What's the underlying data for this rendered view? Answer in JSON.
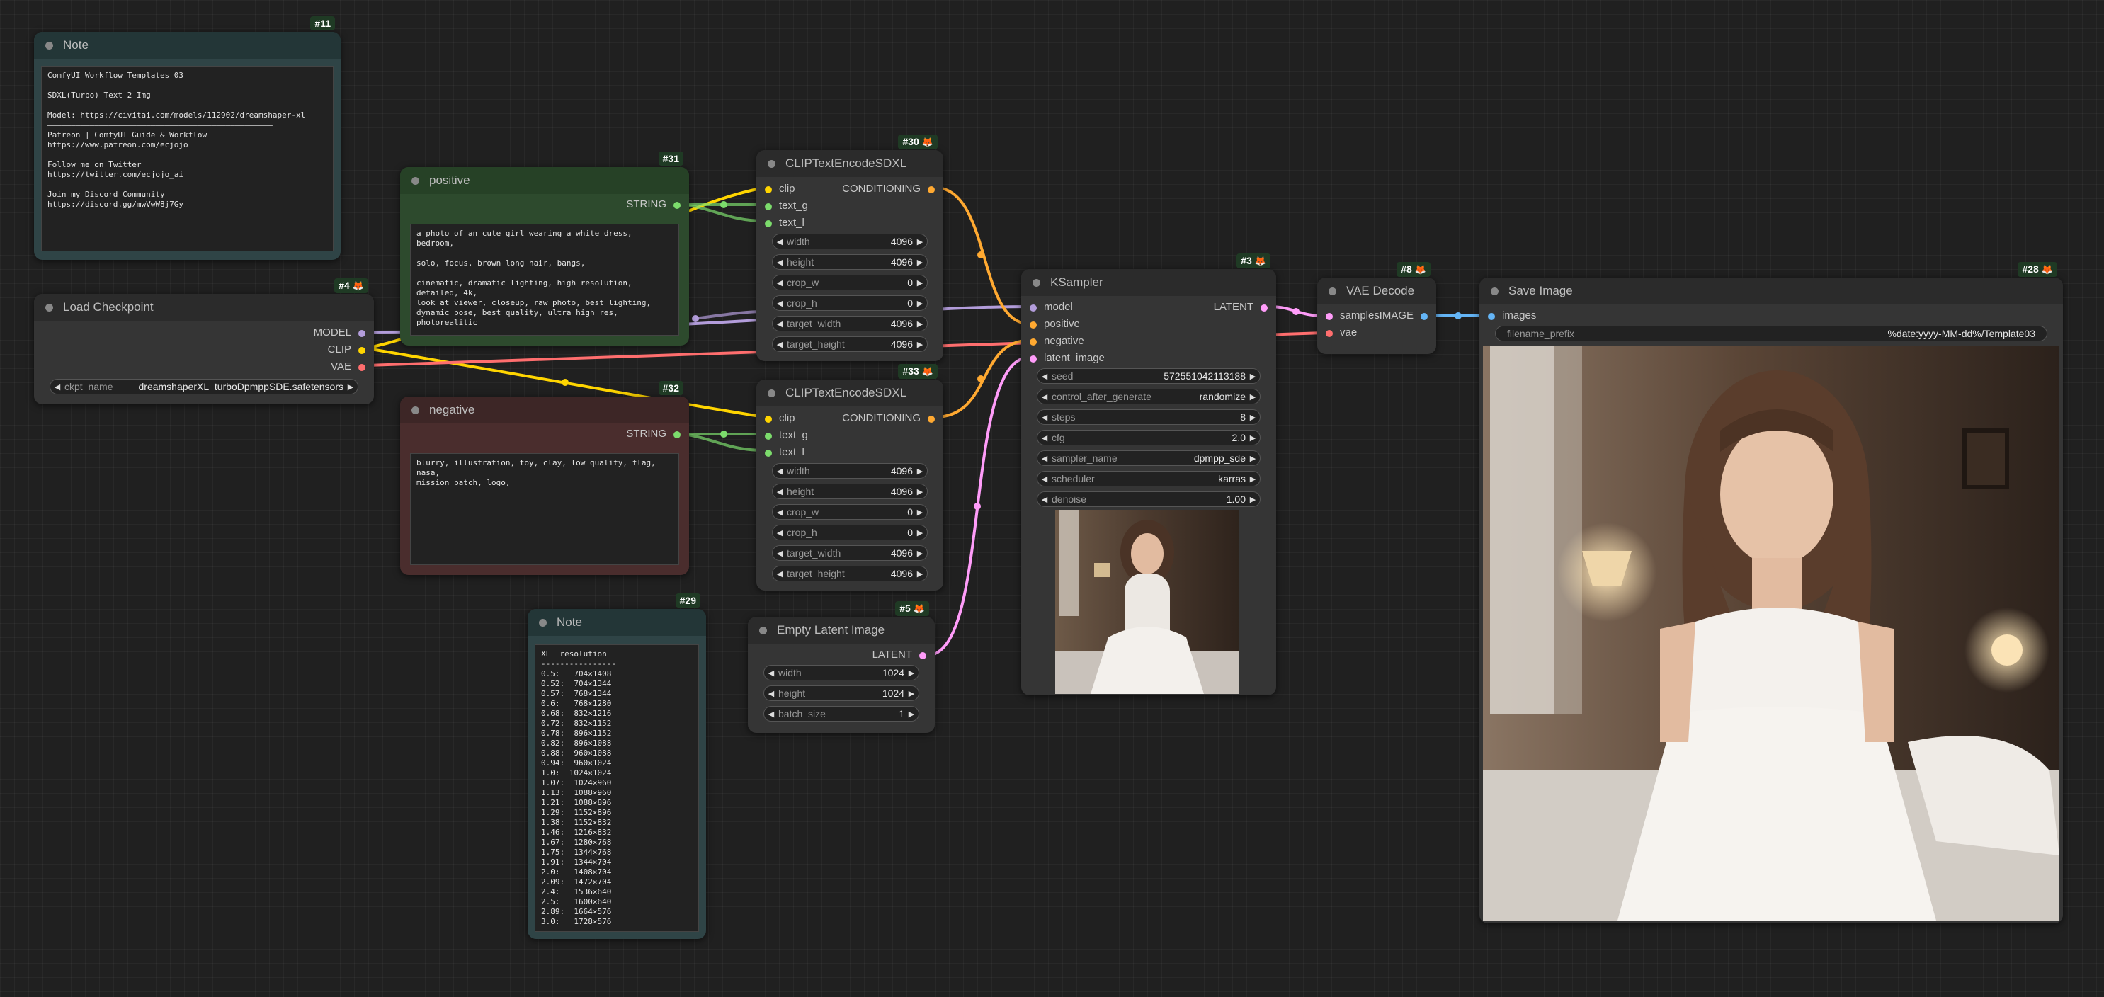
{
  "colors": {
    "model": "#b39ddb",
    "clip": "#ffd500",
    "vae": "#ff6e6e",
    "conditioning": "#ffa931",
    "latent": "#ff9cf9",
    "image": "#64b5f6",
    "string": "#7cdc6c",
    "int": "#aaaaaa"
  },
  "note11": {
    "badge": "#11",
    "title": "Note",
    "text": "ComfyUI Workflow Templates 03\n\nSDXL(Turbo) Text 2 Img\n\nModel: https://civitai.com/models/112902/dreamshaper-xl\n————————————————————————————————————————————————\nPatreon | ComfyUI Guide & Workflow\nhttps://www.patreon.com/ecjojo\n\nFollow me on Twitter\nhttps://twitter.com/ecjojo_ai\n\nJoin my Discord Community\nhttps://discord.gg/mwVwW8j7Gy"
  },
  "positive": {
    "badge": "#31",
    "title": "positive",
    "output": "STRING",
    "text": "a photo of an cute girl wearing a white dress, bedroom,\n\nsolo, focus, brown long hair, bangs,\n\ncinematic, dramatic lighting, high resolution, detailed, 4k,\nlook at viewer, closeup, raw photo, best lighting,\ndynamic pose, best quality, ultra high res, photorealitic"
  },
  "negative": {
    "badge": "#32",
    "title": "negative",
    "output": "STRING",
    "text": "blurry, illustration, toy, clay, low quality, flag, nasa,\nmission patch, logo,"
  },
  "load_checkpoint": {
    "badge": "#4",
    "title": "Load Checkpoint",
    "outputs": [
      "MODEL",
      "CLIP",
      "VAE"
    ],
    "widget_name": "ckpt_name",
    "widget_value": "dreamshaperXL_turboDpmppSDE.safetensors"
  },
  "clip30": {
    "badge": "#30",
    "title": "CLIPTextEncodeSDXL",
    "inputs": [
      "clip",
      "text_g",
      "text_l"
    ],
    "output": "CONDITIONING",
    "widgets": [
      {
        "name": "width",
        "value": "4096"
      },
      {
        "name": "height",
        "value": "4096"
      },
      {
        "name": "crop_w",
        "value": "0"
      },
      {
        "name": "crop_h",
        "value": "0"
      },
      {
        "name": "target_width",
        "value": "4096"
      },
      {
        "name": "target_height",
        "value": "4096"
      }
    ]
  },
  "clip33": {
    "badge": "#33",
    "title": "CLIPTextEncodeSDXL",
    "inputs": [
      "clip",
      "text_g",
      "text_l"
    ],
    "output": "CONDITIONING",
    "widgets": [
      {
        "name": "width",
        "value": "4096"
      },
      {
        "name": "height",
        "value": "4096"
      },
      {
        "name": "crop_w",
        "value": "0"
      },
      {
        "name": "crop_h",
        "value": "0"
      },
      {
        "name": "target_width",
        "value": "4096"
      },
      {
        "name": "target_height",
        "value": "4096"
      }
    ]
  },
  "ksampler": {
    "badge": "#3",
    "title": "KSampler",
    "inputs": [
      "model",
      "positive",
      "negative",
      "latent_image"
    ],
    "output": "LATENT",
    "widgets": [
      {
        "name": "seed",
        "value": "572551042113188"
      },
      {
        "name": "control_after_generate",
        "value": "randomize"
      },
      {
        "name": "steps",
        "value": "8"
      },
      {
        "name": "cfg",
        "value": "2.0"
      },
      {
        "name": "sampler_name",
        "value": "dpmpp_sde"
      },
      {
        "name": "scheduler",
        "value": "karras"
      },
      {
        "name": "denoise",
        "value": "1.00"
      }
    ]
  },
  "vae_decode": {
    "badge": "#8",
    "title": "VAE Decode",
    "inputs": [
      "samples",
      "vae"
    ],
    "output": "IMAGE"
  },
  "save_image": {
    "badge": "#28",
    "title": "Save Image",
    "inputs": [
      "images"
    ],
    "widget_name": "filename_prefix",
    "widget_value": "%date:yyyy-MM-dd%/Template03"
  },
  "empty_latent": {
    "badge": "#5",
    "title": "Empty Latent Image",
    "output": "LATENT",
    "widgets": [
      {
        "name": "width",
        "value": "1024"
      },
      {
        "name": "height",
        "value": "1024"
      },
      {
        "name": "batch_size",
        "value": "1"
      }
    ]
  },
  "note29": {
    "badge": "#29",
    "title": "Note",
    "text": "XL  resolution\n----------------\n0.5:   704×1408\n0.52:  704×1344\n0.57:  768×1344\n0.6:   768×1280\n0.68:  832×1216\n0.72:  832×1152\n0.78:  896×1152\n0.82:  896×1088\n0.88:  960×1088\n0.94:  960×1024\n1.0:  1024×1024\n1.07:  1024×960\n1.13:  1088×960\n1.21:  1088×896\n1.29:  1152×896\n1.38:  1152×832\n1.46:  1216×832\n1.67:  1280×768\n1.75:  1344×768\n1.91:  1344×704\n2.0:   1408×704\n2.09:  1472×704\n2.4:   1536×640\n2.5:   1600×640\n2.89:  1664×576\n3.0:   1728×576"
  }
}
